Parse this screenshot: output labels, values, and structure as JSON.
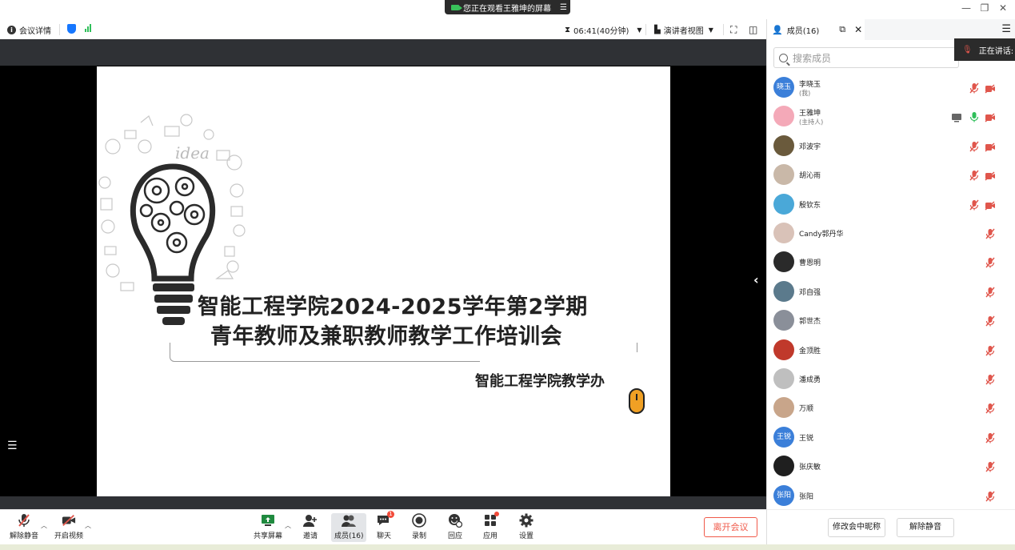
{
  "share_banner": {
    "text": "您正在观看王雅坤的屏幕"
  },
  "infobar": {
    "meeting_details": "会议详情",
    "timer": "06:41(40分钟)",
    "view_mode": "演讲者视图"
  },
  "slide": {
    "title_line1": "智能工程学院2024-2025学年第2学期",
    "title_line2": "青年教师及兼职教师教学工作培训会",
    "organizer": "智能工程学院教学办",
    "idea_word": "idea"
  },
  "toolbar": {
    "unmute": "解除静音",
    "start_video": "开启视频",
    "share_screen": "共享屏幕",
    "invite": "邀请",
    "members": "成员(16)",
    "chat": "聊天",
    "chat_badge": "1",
    "record": "录制",
    "replay": "回应",
    "apps": "应用",
    "settings": "设置",
    "leave": "离开会议"
  },
  "panel": {
    "tab_label": "成员(16)",
    "search_placeholder": "搜索成员",
    "speaking_label": "正在讲话:",
    "members": [
      {
        "name": "李晓玉",
        "sub": "(我)",
        "avatar_text": "晓玉",
        "avatar_color": "#3b7fd9"
      },
      {
        "name": "王雅坤",
        "sub": "(主持人)",
        "avatar_text": "",
        "avatar_color": "#f4a9b8"
      },
      {
        "name": "邓波宇",
        "sub": "",
        "avatar_text": "",
        "avatar_color": "#6a5a3c"
      },
      {
        "name": "胡沁雨",
        "sub": "",
        "avatar_text": "",
        "avatar_color": "#c9b8a8"
      },
      {
        "name": "殷钦东",
        "sub": "",
        "avatar_text": "",
        "avatar_color": "#4aa8d8"
      },
      {
        "name": "Candy郭丹华",
        "sub": "",
        "avatar_text": "",
        "avatar_color": "#d9c2b8"
      },
      {
        "name": "曹恩明",
        "sub": "",
        "avatar_text": "",
        "avatar_color": "#2a2a2a"
      },
      {
        "name": "邓自强",
        "sub": "",
        "avatar_text": "",
        "avatar_color": "#5b7a8c"
      },
      {
        "name": "郭世杰",
        "sub": "",
        "avatar_text": "",
        "avatar_color": "#8a8f99"
      },
      {
        "name": "金顶胜",
        "sub": "",
        "avatar_text": "",
        "avatar_color": "#c0392b"
      },
      {
        "name": "潘成勇",
        "sub": "",
        "avatar_text": "",
        "avatar_color": "#bfbfbf"
      },
      {
        "name": "万顺",
        "sub": "",
        "avatar_text": "",
        "avatar_color": "#c8a58a"
      },
      {
        "name": "王锐",
        "sub": "",
        "avatar_text": "王锐",
        "avatar_color": "#3b7fd9"
      },
      {
        "name": "张庆敏",
        "sub": "",
        "avatar_text": "",
        "avatar_color": "#1f1f1f"
      },
      {
        "name": "张阳",
        "sub": "",
        "avatar_text": "张阳",
        "avatar_color": "#3b7fd9"
      }
    ],
    "rename_button": "修改会中昵称",
    "unmute_button": "解除静音"
  },
  "colors": {
    "accent": "#1677ff",
    "leave_red": "#f05a4a",
    "signal_green": "#2fbf5a",
    "mic_muted": "#e0564c",
    "mic_active": "#2fbf5a"
  }
}
